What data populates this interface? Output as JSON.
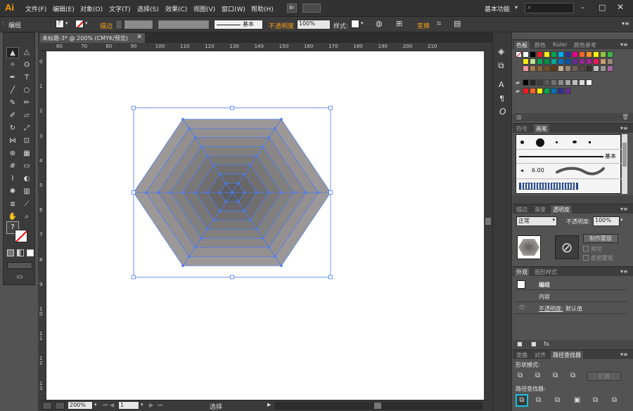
{
  "app": {
    "logo": "Ai",
    "menu": [
      "文件(F)",
      "编辑(E)",
      "对象(O)",
      "文字(T)",
      "选择(S)",
      "效果(C)",
      "视图(V)",
      "窗口(W)",
      "帮助(H)"
    ],
    "workspace": "基本功能",
    "bridge_label": "Br"
  },
  "control": {
    "selection_label": "编组",
    "stroke_label": "描边",
    "brush_label": "基本",
    "opacity_label": "不透明度",
    "opacity_value": "100%",
    "style_label": "样式:",
    "transform_label": "变换"
  },
  "document": {
    "tab_title": "未标题-3* @ 200% (CMYK/预览)",
    "ruler_top": [
      "60",
      "70",
      "80",
      "90",
      "100",
      "110",
      "120",
      "130",
      "140",
      "150",
      "160",
      "170",
      "180",
      "190",
      "200",
      "210"
    ],
    "ruler_left": [
      "0",
      "1",
      "2",
      "3",
      "4",
      "5",
      "6",
      "7",
      "8",
      "9",
      "10",
      "11",
      "12",
      "13",
      "14"
    ]
  },
  "status": {
    "zoom": "200%",
    "page": "1",
    "tool_status": "选择"
  },
  "panels": {
    "swatches": {
      "tabs": [
        "色板",
        "颜色",
        "Kuler",
        "颜色参考"
      ],
      "colors_row1": [
        "#ffffff",
        "#000000",
        "#ee1c25",
        "#f7ec13",
        "#00a651",
        "#00aeef",
        "#2e3192",
        "#ec008c",
        "#f26522",
        "#f7941d",
        "#fff200",
        "#8dc63f",
        "#39b54a"
      ],
      "colors_row2": [
        "#f7ec13",
        "#c4df9b",
        "#00a651",
        "#009444",
        "#00a99d",
        "#0072bc",
        "#0054a6",
        "#662d91",
        "#92278f",
        "#a3238e",
        "#ed145b",
        "#c69c6d",
        "#998675"
      ],
      "colors_row3": [
        "#f6989d",
        "#a67c52",
        "#8c6239",
        "#754c24",
        "#603913",
        "#c7b299",
        "#998675",
        "#736357",
        "#534741",
        "#362f2d",
        "#c2c2c2",
        "#959595",
        "#a864a8"
      ],
      "colors_row4": [
        "#000000",
        "#262626",
        "#404040",
        "#595959",
        "#737373",
        "#8c8c8c",
        "#a6a6a6",
        "#bfbfbf",
        "#d9d9d9",
        "#f2f2f2"
      ],
      "colors_row5": [
        "#ee1c25",
        "#f26522",
        "#fff200",
        "#00a651",
        "#0072bc",
        "#2e3192",
        "#662d91"
      ]
    },
    "brushes": {
      "tabs": [
        "符号",
        "画笔"
      ],
      "basic_label": "基本",
      "size_label": "6.00"
    },
    "transparency": {
      "tabs": [
        "描边",
        "渐变",
        "透明度"
      ],
      "blend_mode": "正常",
      "opacity_label": "不透明度:",
      "opacity_value": "100%",
      "make_mask_label": "制作蒙版",
      "clip_label": "剪切",
      "invert_mask_label": "反相蒙版"
    },
    "appearance": {
      "tabs": [
        "外观",
        "图形样式"
      ],
      "group_label": "编组",
      "contents_label": "内容",
      "opacity_label": "不透明度:",
      "opacity_value": "默认值"
    },
    "pathfinder": {
      "tabs": [
        "变换",
        "对齐",
        "路径查找器"
      ],
      "shape_modes_label": "形状模式:",
      "expand_label": "扩展",
      "pathfinders_label": "路径查找器:"
    }
  },
  "colors": {
    "accent": "#f7a11a",
    "selection": "#4b7cf3",
    "hexagon_outer": "#9d9898",
    "hexagon_inner": "#5f5e5e"
  }
}
